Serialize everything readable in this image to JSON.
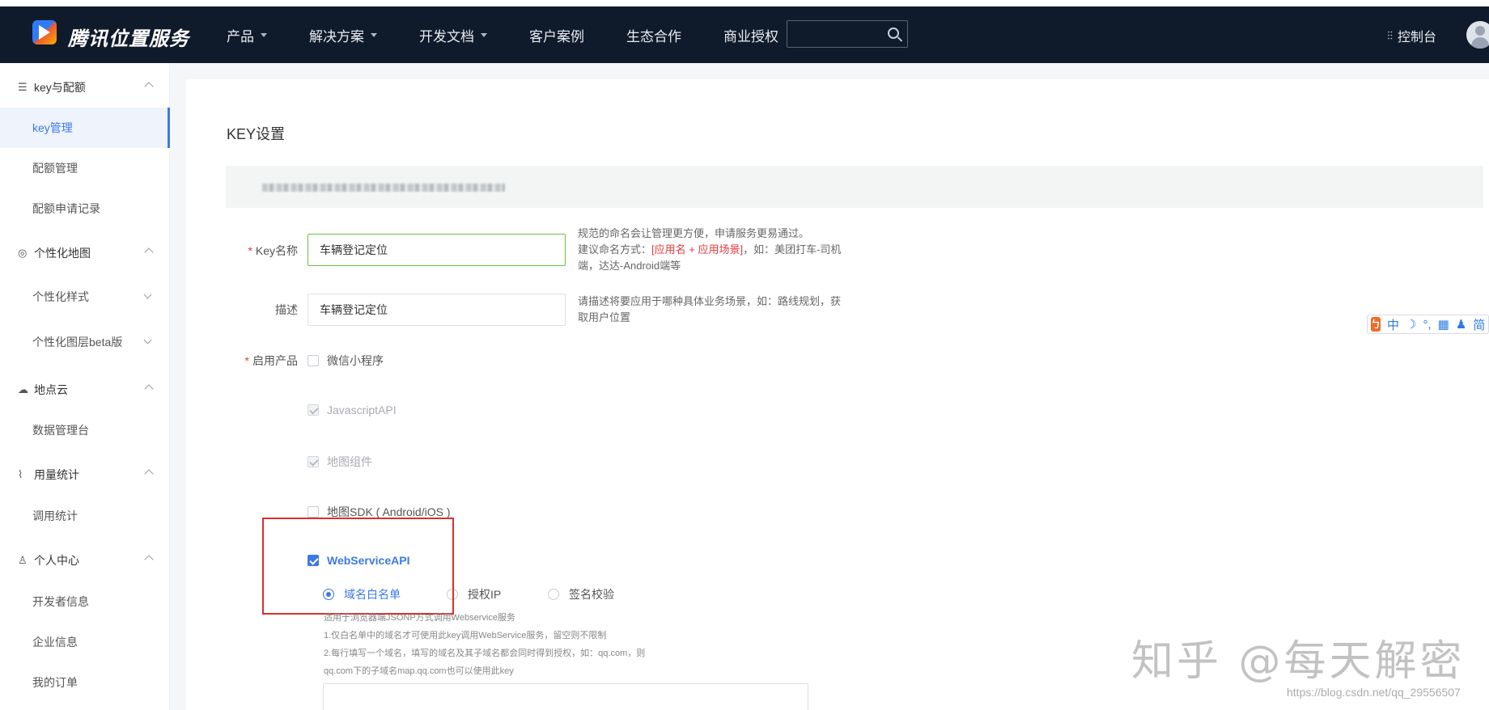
{
  "header": {
    "brand": "腾讯位置服务",
    "nav": [
      {
        "label": "产品",
        "has_caret": true
      },
      {
        "label": "解决方案",
        "has_caret": true
      },
      {
        "label": "开发文档",
        "has_caret": true
      },
      {
        "label": "客户案例",
        "has_caret": false
      },
      {
        "label": "生态合作",
        "has_caret": false
      },
      {
        "label": "商业授权",
        "has_caret": false
      }
    ],
    "search_placeholder": "",
    "console_label": "控制台",
    "console_icon": "sliders-icon"
  },
  "sidebar": {
    "groups": [
      {
        "label": "key与配额",
        "icon": "☰",
        "items": [
          {
            "label": "key管理",
            "active": true
          },
          {
            "label": "配额管理"
          },
          {
            "label": "配额申请记录"
          }
        ]
      },
      {
        "label": "个性化地图",
        "icon": "◎",
        "items": [
          {
            "label": "个性化样式",
            "expandable": true
          },
          {
            "label": "个性化图层beta版",
            "expandable": true
          }
        ]
      },
      {
        "label": "地点云",
        "icon": "☁",
        "items": [
          {
            "label": "数据管理台"
          }
        ]
      },
      {
        "label": "用量统计",
        "icon": "⌇",
        "items": [
          {
            "label": "调用统计"
          }
        ]
      },
      {
        "label": "个人中心",
        "icon": "♙",
        "items": [
          {
            "label": "开发者信息"
          },
          {
            "label": "企业信息"
          },
          {
            "label": "我的订单"
          }
        ]
      }
    ]
  },
  "main": {
    "title": "KEY设置",
    "form": {
      "key_name": {
        "label": "Key名称",
        "value": "车辆登记定位",
        "required": true
      },
      "key_name_hint": {
        "line1": "规范的命名会让管理更方便，申请服务更易通过。",
        "line2_prefix": "建议命名方式：",
        "line2_red": "[应用名 + 应用场景]",
        "line2_suffix": "，如：美团打车-司机",
        "line3": "端，达达-Android端等"
      },
      "desc": {
        "label": "描述",
        "value": "车辆登记定位"
      },
      "desc_hint": {
        "line1": "请描述将要应用于哪种具体业务场景，如：路线规划，获",
        "line2": "取用户位置"
      },
      "products_label": "启用产品",
      "products": [
        {
          "label": "微信小程序",
          "state": "unchecked"
        },
        {
          "label": "JavascriptAPI",
          "state": "disabled-checked"
        },
        {
          "label": "地图组件",
          "state": "disabled-checked"
        },
        {
          "label": "地图SDK ( Android/iOS )",
          "state": "unchecked"
        },
        {
          "label": "WebServiceAPI",
          "state": "checked"
        }
      ],
      "auth_options": [
        {
          "label": "域名白名单",
          "selected": true
        },
        {
          "label": "授权IP",
          "selected": false
        },
        {
          "label": "签名校验",
          "selected": false
        }
      ],
      "notes": [
        "适用于浏览器端JSONP方式调用Webservice服务",
        "1.仅白名单中的域名才可使用此key调用WebService服务，留空则不限制",
        "2.每行填写一个域名，填写的域名及其子域名都会同时得到授权，如：qq.com，则",
        "qq.com下的子域名map.qq.com也可以使用此key"
      ]
    }
  },
  "ime": {
    "items": [
      "中",
      "☽",
      "°,",
      "▦",
      "♟",
      "简"
    ]
  },
  "watermark": {
    "text": "知乎 @每天解密",
    "url": "https://blog.csdn.net/qq_29556507"
  }
}
